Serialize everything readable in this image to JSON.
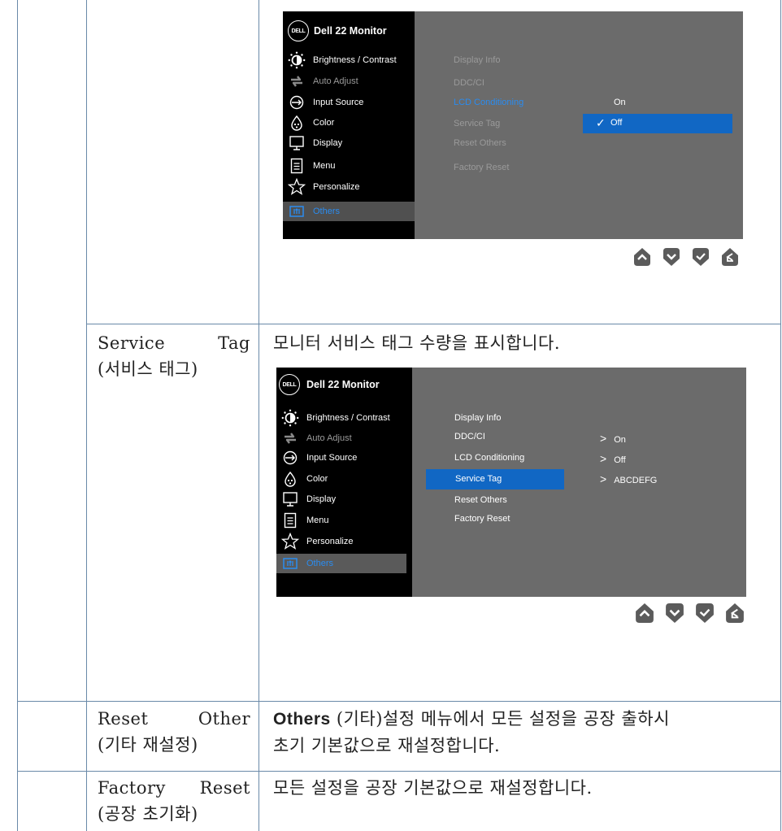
{
  "rows": [
    {
      "label_words": [],
      "label_sub": "",
      "desc": ""
    },
    {
      "label_words": [
        "Service",
        "Tag"
      ],
      "label_sub": "(서비스 태그)",
      "desc": "모니터 서비스 태그 수량을 표시합니다."
    },
    {
      "label_words": [
        "Reset",
        "Other"
      ],
      "label_sub": "(기타 재설정)",
      "desc_bold": "Others",
      "desc_rest": " (기타)설정 메뉴에서 모든 설정을 공장 출하시",
      "desc_line2": "초기 기본값으로 재설정합니다."
    },
    {
      "label_words": [
        "Factory",
        "Reset"
      ],
      "label_sub": "(공장 초기화)",
      "desc": "모든 설정을 공장 기본값으로 재설정합니다."
    }
  ],
  "osd": {
    "logo": "DELL",
    "title": "Dell 22 Monitor",
    "menu": [
      {
        "label": "Brightness / Contrast",
        "icon": "brightness-icon"
      },
      {
        "label": "Auto Adjust",
        "icon": "auto-adjust-icon"
      },
      {
        "label": "Input Source",
        "icon": "input-source-icon"
      },
      {
        "label": "Color",
        "icon": "color-icon"
      },
      {
        "label": "Display",
        "icon": "display-icon"
      },
      {
        "label": "Menu",
        "icon": "menu-icon"
      },
      {
        "label": "Personalize",
        "icon": "personalize-icon"
      },
      {
        "label": "Others",
        "icon": "others-icon"
      }
    ],
    "submenu": [
      "Display Info",
      "DDC/CI",
      "LCD Conditioning",
      "Service Tag",
      "Reset Others",
      "Factory Reset"
    ],
    "screen1": {
      "options": [
        "On",
        "Off"
      ],
      "checkmark": "✓"
    },
    "screen2": {
      "values": [
        "On",
        "Off",
        "ABCDEFG"
      ],
      "arrow": ">"
    }
  },
  "nav_buttons": [
    "up-button",
    "down-button",
    "ok-button",
    "back-button"
  ],
  "colors": {
    "osd_bg": "#000000",
    "panel": "#6b6b6b",
    "highlight": "#1167c4",
    "link_blue": "#2a8cf0",
    "button": "#5b5b5b",
    "border": "#6a89a8"
  }
}
